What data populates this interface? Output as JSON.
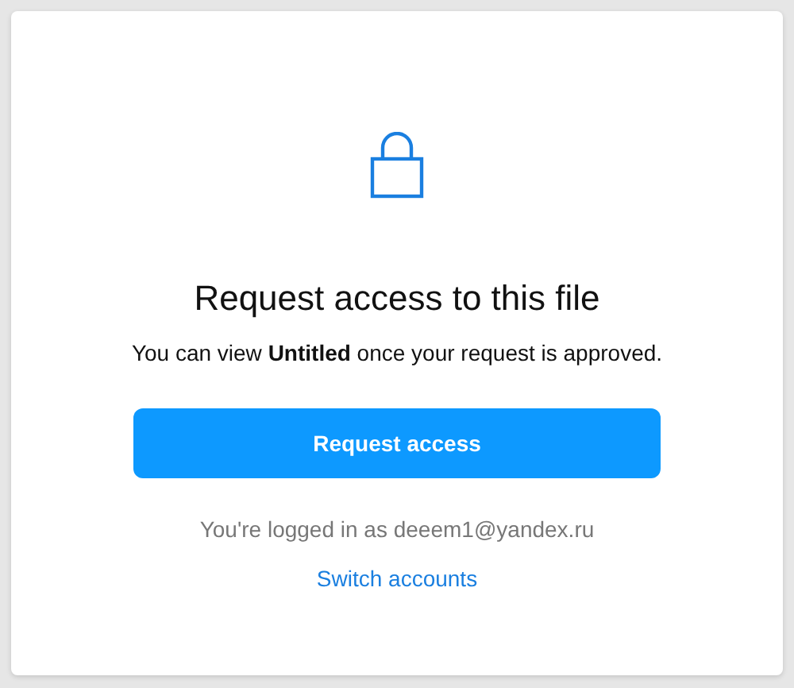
{
  "dialog": {
    "title": "Request access to this file",
    "message": "You can view **Untitled** once your request is approved.",
    "primary_button": "Request access",
    "account_note": "You're logged in as deeem1@yandex.ru",
    "switch_link": "Switch accounts"
  }
}
